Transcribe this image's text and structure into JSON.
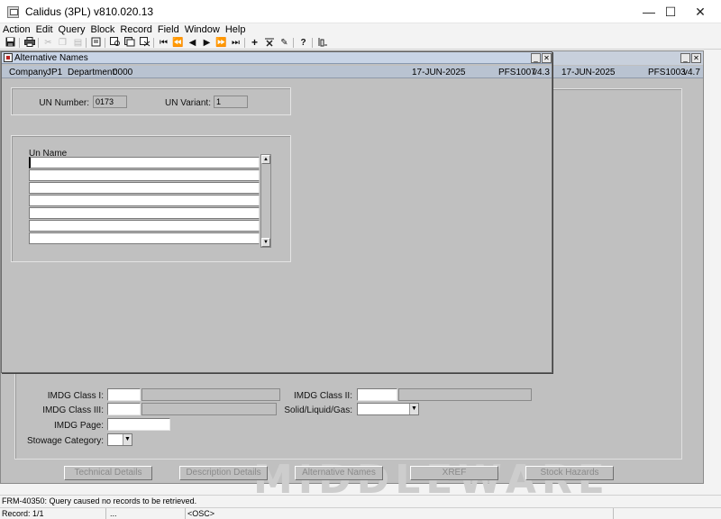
{
  "app": {
    "title": "Calidus (3PL) v810.020.13"
  },
  "window_controls": {
    "minimize": "—",
    "maximize": "☐",
    "close": "✕"
  },
  "menu": [
    "Action",
    "Edit",
    "Query",
    "Block",
    "Record",
    "Field",
    "Window",
    "Help"
  ],
  "toolbar": {
    "icons": [
      "save-icon",
      "print-icon",
      "cut-icon",
      "copy-icon",
      "paste-icon",
      "clear-icon",
      "enter-query-icon",
      "execute-query-icon",
      "cancel-query-icon",
      "first-record-icon",
      "previous-block-icon",
      "previous-record-icon",
      "next-record-icon",
      "next-block-icon",
      "last-record-icon",
      "insert-record-icon",
      "delete-record-icon",
      "edit-icon",
      "help-icon",
      "keys-icon"
    ]
  },
  "background_form": {
    "info": {
      "date": "17-JUN-2025",
      "form_id": "PFS1003",
      "version": "v4.7"
    },
    "fields": {
      "imdg_class_1": {
        "label": "IMDG Class I:",
        "value": ""
      },
      "imdg_class_2": {
        "label": "IMDG Class II:",
        "value": ""
      },
      "imdg_class_3": {
        "label": "IMDG Class III:",
        "value": ""
      },
      "solid_liquid_gas": {
        "label": "Solid/Liquid/Gas:",
        "value": ""
      },
      "imdg_page": {
        "label": "IMDG Page:",
        "value": ""
      },
      "stowage_category": {
        "label": "Stowage Category:",
        "value": ""
      }
    },
    "buttons": {
      "technical_details": "Technical Details",
      "description_details": "Description Details",
      "alternative_names": "Alternative Names",
      "xref": "XREF",
      "stock_hazards": "Stock Hazards"
    },
    "watermark": "MIDDLEWARE"
  },
  "dialog": {
    "title": "Alternative Names",
    "info": {
      "company_label": "Company:",
      "company": "JP1",
      "department_label": "Department:",
      "department": "0000",
      "date": "17-JUN-2025",
      "form_id": "PFS1007",
      "version": "v4.3"
    },
    "un_number": {
      "label": "UN Number:",
      "value": "0173"
    },
    "un_variant": {
      "label": "UN Variant:",
      "value": "1"
    },
    "grid": {
      "header": "Un Name",
      "rows": [
        "",
        "",
        "",
        "",
        "",
        "",
        ""
      ]
    }
  },
  "status": {
    "message": "FRM-40350: Query caused no records to be retrieved."
  },
  "record_bar": {
    "record": "Record: 1/1",
    "indicator": "...",
    "mode": "<OSC>"
  }
}
